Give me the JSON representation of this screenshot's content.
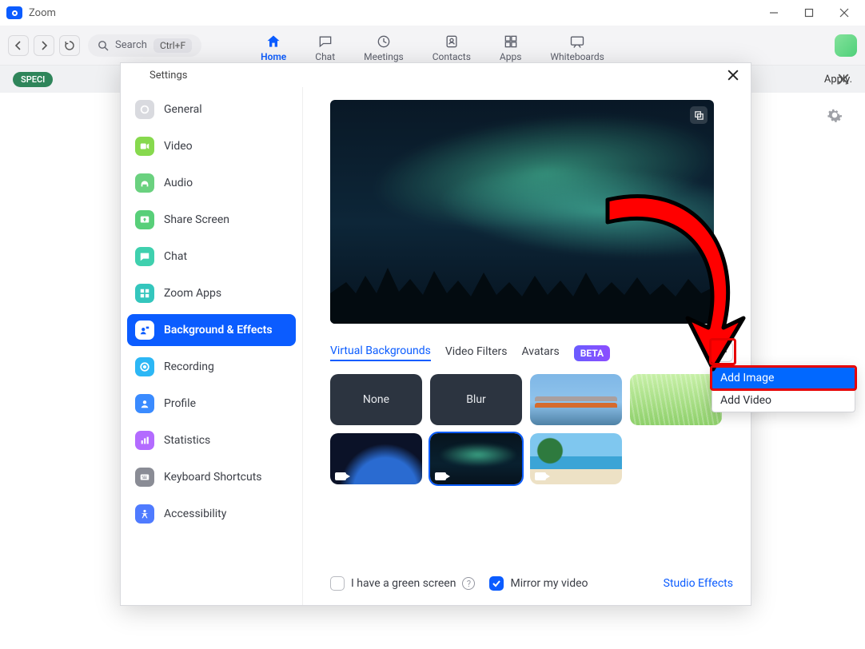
{
  "window": {
    "title": "Zoom"
  },
  "toolbar": {
    "search_placeholder": "Search",
    "search_kbd": "Ctrl+F",
    "tabs": {
      "home": "Home",
      "chat": "Chat",
      "meetings": "Meetings",
      "contacts": "Contacts",
      "apps": "Apps",
      "whiteboards": "Whiteboards"
    }
  },
  "banner": {
    "chip": "SPECI",
    "tail": "Apply."
  },
  "settings": {
    "title": "Settings",
    "sidebar": [
      {
        "key": "general",
        "label": "General",
        "color": "#d9dadf"
      },
      {
        "key": "video",
        "label": "Video",
        "color": "#87d94e"
      },
      {
        "key": "audio",
        "label": "Audio",
        "color": "#6ad17f"
      },
      {
        "key": "share",
        "label": "Share Screen",
        "color": "#58cf79"
      },
      {
        "key": "chat",
        "label": "Chat",
        "color": "#3fd0ae"
      },
      {
        "key": "zoomapps",
        "label": "Zoom Apps",
        "color": "#34c6bd"
      },
      {
        "key": "bgfx",
        "label": "Background & Effects",
        "color": "#0b5cff"
      },
      {
        "key": "recording",
        "label": "Recording",
        "color": "#2cb7f5"
      },
      {
        "key": "profile",
        "label": "Profile",
        "color": "#3a8bff"
      },
      {
        "key": "stats",
        "label": "Statistics",
        "color": "#b36bff"
      },
      {
        "key": "shortcuts",
        "label": "Keyboard Shortcuts",
        "color": "#8a8c95"
      },
      {
        "key": "a11y",
        "label": "Accessibility",
        "color": "#4f7bff"
      }
    ],
    "active_sidebar": "bgfx",
    "subtabs": {
      "vb": "Virtual Backgrounds",
      "filters": "Video Filters",
      "avatars": "Avatars",
      "beta": "BETA"
    },
    "thumbs": {
      "none": "None",
      "blur": "Blur"
    },
    "footer": {
      "greenscreen": "I have a green screen",
      "mirror": "Mirror my video",
      "studio": "Studio Effects"
    },
    "addmenu": {
      "add_image": "Add Image",
      "add_video": "Add Video"
    }
  }
}
